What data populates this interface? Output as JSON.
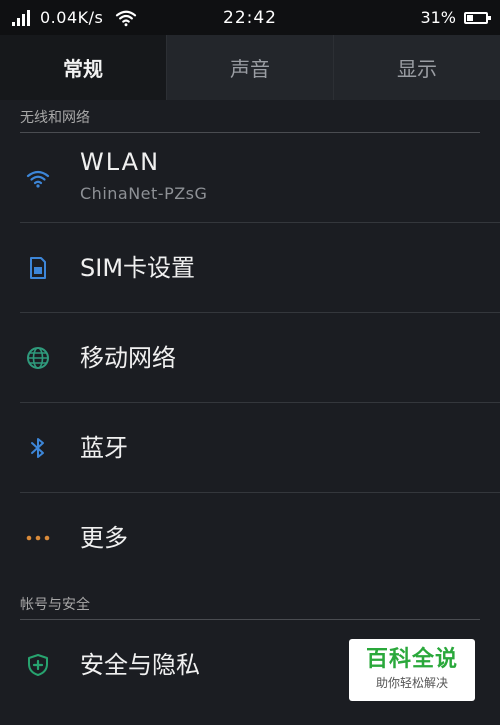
{
  "status_bar": {
    "net_speed": "0.04K/s",
    "time": "22:42",
    "battery_percent": "31%",
    "battery_level": 0.31
  },
  "tabs": [
    {
      "label": "常规",
      "active": true
    },
    {
      "label": "声音",
      "active": false
    },
    {
      "label": "显示",
      "active": false
    }
  ],
  "sections": {
    "wireless": {
      "header": "无线和网络",
      "items": [
        {
          "title": "WLAN",
          "subtitle": "ChinaNet-PZsG",
          "icon": "wifi-icon",
          "icon_color": "#3d86d8"
        },
        {
          "title": "SIM卡设置",
          "icon": "sim-card-icon",
          "icon_color": "#3d86d8"
        },
        {
          "title": "移动网络",
          "icon": "globe-icon",
          "icon_color": "#2f9a7c"
        },
        {
          "title": "蓝牙",
          "icon": "bluetooth-icon",
          "icon_color": "#3d86d8"
        },
        {
          "title": "更多",
          "icon": "more-dots-icon",
          "icon_color": "#d98a3a"
        }
      ]
    },
    "account": {
      "header": "帐号与安全",
      "items": [
        {
          "title": "安全与隐私",
          "icon": "shield-icon",
          "icon_color": "#27a36f"
        }
      ]
    }
  },
  "watermark": {
    "title": "百科全说",
    "subtitle": "助你轻松解决"
  }
}
